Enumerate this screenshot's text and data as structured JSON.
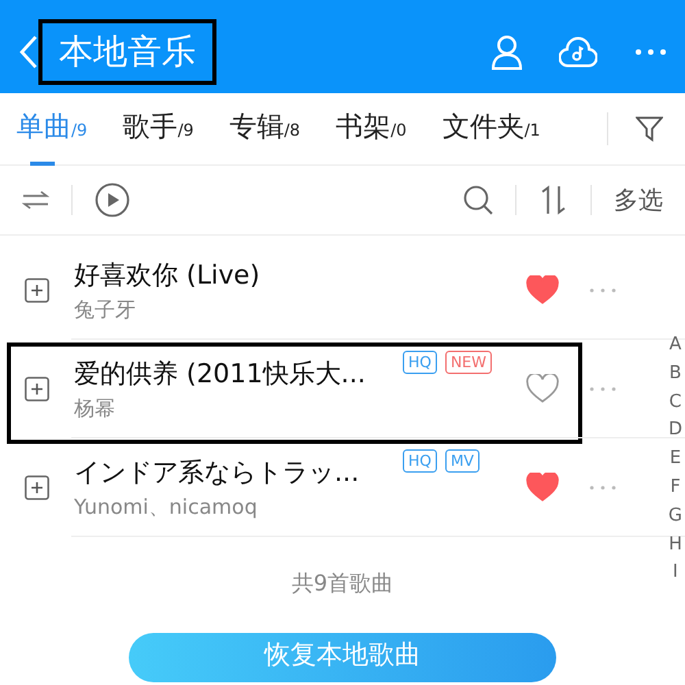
{
  "header": {
    "title": "本地音乐",
    "highlighted": true
  },
  "tabs": [
    {
      "label": "单曲",
      "count": "/9",
      "selected": true
    },
    {
      "label": "歌手",
      "count": "/9",
      "selected": false
    },
    {
      "label": "专辑",
      "count": "/8",
      "selected": false
    },
    {
      "label": "书架",
      "count": "/0",
      "selected": false
    },
    {
      "label": "文件夹",
      "count": "/1",
      "selected": false
    }
  ],
  "toolbar": {
    "multi_select": "多选"
  },
  "songs": [
    {
      "title": "好喜欢你 (Live)",
      "artist": "兔子牙",
      "liked": true,
      "highlighted": false
    },
    {
      "title": "爱的供养 (2011快乐大...",
      "artist": "杨幂",
      "tags": [
        {
          "label": "HQ",
          "color": "#3a9ff0"
        },
        {
          "label": "NEW",
          "color": "#f36f6f"
        }
      ],
      "liked": false,
      "highlighted": true
    },
    {
      "title": "インドア系ならトラッ...",
      "artist": "Yunomi、nicamoq",
      "tags": [
        {
          "label": "HQ",
          "color": "#3a9ff0"
        },
        {
          "label": "MV",
          "color": "#3a9ff0"
        }
      ],
      "liked": true,
      "highlighted": false
    }
  ],
  "index_letters": [
    "A",
    "B",
    "C",
    "D",
    "E",
    "F",
    "G",
    "H",
    "I"
  ],
  "footer": {
    "count_text": "共9首歌曲",
    "restore_button": "恢复本地歌曲"
  }
}
